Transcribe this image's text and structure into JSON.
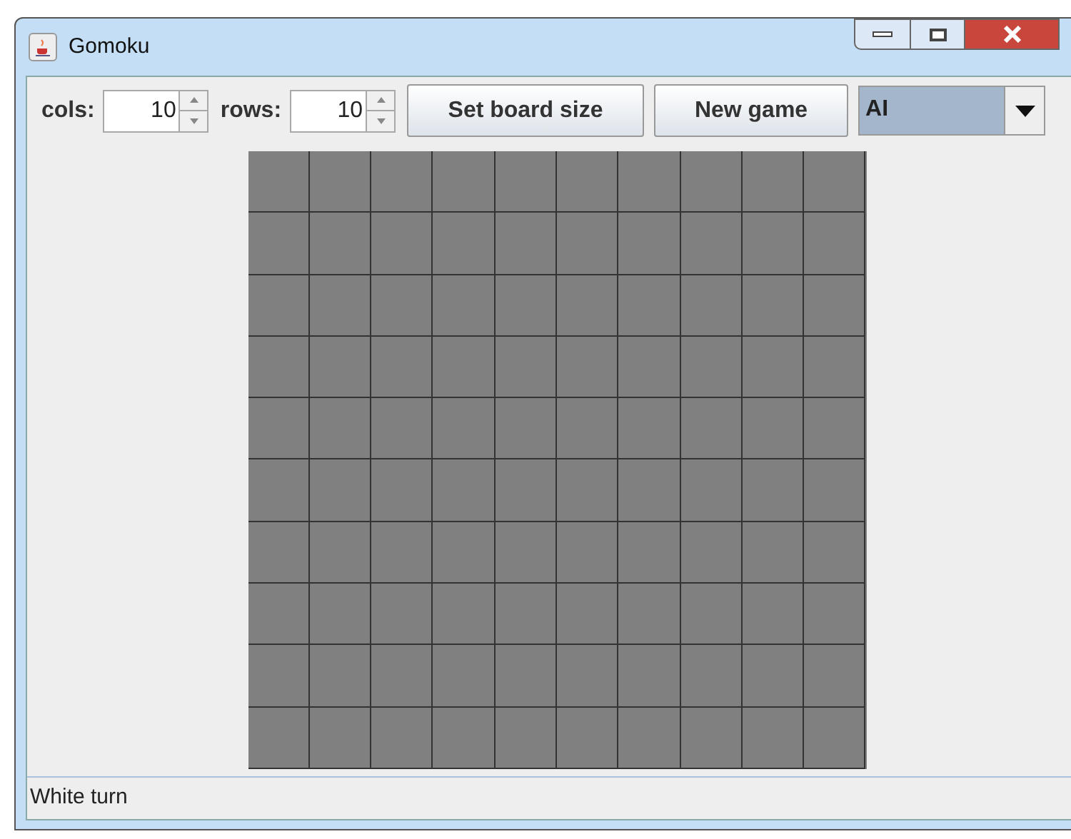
{
  "window": {
    "title": "Gomoku"
  },
  "toolbar": {
    "cols_label": "cols:",
    "cols_value": "10",
    "rows_label": "rows:",
    "rows_value": "10",
    "buttons": [
      "Set board size",
      "New game"
    ],
    "mode": {
      "value": "AI"
    }
  },
  "board": {
    "rows": [
      [
        {
          "stone": false
        },
        {
          "stone": false
        },
        {
          "stone": false
        },
        {
          "stone": false
        },
        {
          "stone": false
        },
        {
          "stone": false
        },
        {
          "stone": false
        },
        {
          "stone": false
        },
        {
          "stone": false
        },
        {
          "stone": false
        }
      ],
      [
        {
          "stone": false
        },
        {
          "stone": false
        },
        {
          "stone": false
        },
        {
          "stone": false
        },
        {
          "stone": false
        },
        {
          "stone": false
        },
        {
          "stone": false
        },
        {
          "stone": false
        },
        {
          "stone": false
        },
        {
          "stone": false
        }
      ],
      [
        {
          "stone": false
        },
        {
          "stone": false
        },
        {
          "stone": false
        },
        {
          "stone": false
        },
        {
          "stone": false
        },
        {
          "stone": false
        },
        {
          "stone": false
        },
        {
          "stone": false
        },
        {
          "stone": false
        },
        {
          "stone": false
        }
      ],
      [
        {
          "stone": false
        },
        {
          "stone": false
        },
        {
          "stone": false
        },
        {
          "stone": false
        },
        {
          "stone": false
        },
        {
          "stone": false
        },
        {
          "stone": false
        },
        {
          "stone": false
        },
        {
          "stone": false
        },
        {
          "stone": false
        }
      ],
      [
        {
          "stone": false
        },
        {
          "stone": false
        },
        {
          "stone": false
        },
        {
          "stone": false
        },
        {
          "stone": false
        },
        {
          "stone": false
        },
        {
          "stone": false
        },
        {
          "stone": false
        },
        {
          "stone": false
        },
        {
          "stone": false
        }
      ],
      [
        {
          "stone": false
        },
        {
          "stone": false
        },
        {
          "stone": false
        },
        {
          "stone": false
        },
        {
          "stone": false
        },
        {
          "stone": false
        },
        {
          "stone": false
        },
        {
          "stone": false
        },
        {
          "stone": false
        },
        {
          "stone": false
        }
      ],
      [
        {
          "stone": false
        },
        {
          "stone": false
        },
        {
          "stone": false
        },
        {
          "stone": false
        },
        {
          "stone": false
        },
        {
          "stone": false
        },
        {
          "stone": false
        },
        {
          "stone": false
        },
        {
          "stone": false
        },
        {
          "stone": false
        }
      ],
      [
        {
          "stone": false
        },
        {
          "stone": false
        },
        {
          "stone": false
        },
        {
          "stone": false
        },
        {
          "stone": false
        },
        {
          "stone": false
        },
        {
          "stone": false
        },
        {
          "stone": false
        },
        {
          "stone": false
        },
        {
          "stone": false
        }
      ],
      [
        {
          "stone": false
        },
        {
          "stone": false
        },
        {
          "stone": false
        },
        {
          "stone": false
        },
        {
          "stone": false
        },
        {
          "stone": false
        },
        {
          "stone": false
        },
        {
          "stone": false
        },
        {
          "stone": false
        },
        {
          "stone": false
        }
      ],
      [
        {
          "stone": false
        },
        {
          "stone": false
        },
        {
          "stone": false
        },
        {
          "stone": false
        },
        {
          "stone": false
        },
        {
          "stone": false
        },
        {
          "stone": false
        },
        {
          "stone": false
        },
        {
          "stone": false
        },
        {
          "stone": false
        }
      ]
    ]
  },
  "status_bar": "White turn"
}
